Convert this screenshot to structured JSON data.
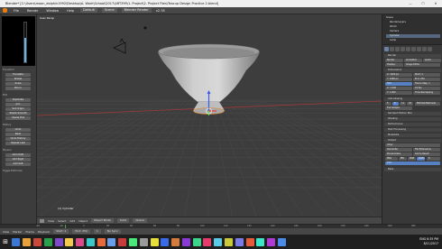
{
  "window": {
    "title": "Blender* [C:\\Users\\moon_dolphin1992\\Desktop\\A. Work\\School\\2017\\ART399\\1. Project\\2. Project Files\\Teacup Design Practice 2.blend]"
  },
  "info_header": {
    "menus": [
      "File",
      "Render",
      "Window",
      "Help"
    ],
    "layout": "Default",
    "scene": "Scene",
    "engine": "Blender Render",
    "version": "v2.78",
    "stats": "Verts:64 | Faces:62 | Tris:120 | Objects:1/3 | Lamps:0/1 | Mem:8.64M | Cylinder"
  },
  "tool_shelf": {
    "sections": [
      {
        "label": "Transform",
        "buttons": [
          "Translate",
          "Rotate",
          "Scale",
          "Mirror"
        ]
      },
      {
        "label": "Edit",
        "buttons": [
          "Duplicate",
          "Join",
          "Set Origin",
          "Shade Smooth",
          "Shade Flat"
        ]
      },
      {
        "label": "History",
        "buttons": [
          "Undo",
          "Redo",
          "Undo History",
          "Repeat Last"
        ]
      },
      {
        "label": "Physics",
        "buttons": [
          "Add Cloth",
          "Add Rigid",
          "Add Soft"
        ]
      }
    ],
    "footer": "Toggle Editmode",
    "brush_level": 0.62
  },
  "viewport": {
    "label": "User Persp",
    "object_label": "(1) Cylinder",
    "header": {
      "view": "View",
      "select": "Select",
      "add": "Add",
      "object": "Object",
      "mode": "Object Mode",
      "shading": "Solid",
      "pivot": "Global"
    }
  },
  "outliner": {
    "rows": [
      "Scene",
      "RenderLayers",
      "World",
      "Camera",
      "Cylinder",
      "Lamp"
    ],
    "active": 4
  },
  "properties": {
    "sections": [
      "Render",
      "Dimensions",
      "Anti-Aliasing",
      "Sampled Motion Blur",
      "Shading",
      "Performance",
      "Post Processing",
      "Metadata",
      "Output",
      "Bake"
    ],
    "render_buttons": [
      "Render",
      "Animation",
      "Audio"
    ],
    "display": "Display:",
    "display_value": "Image Editor",
    "resolution_x": "X: 1920 px",
    "resolution_y": "Y: 1080 px",
    "resolution_pct": "50%",
    "frame_start": "Start: 1",
    "frame_end": "End: 250",
    "frame_step": "Frame Step: 1",
    "aspect_x": "X: 1.000",
    "aspect_y": "Y: 1.000",
    "fps": "24 fps",
    "time_remap": "Time Remapping",
    "aa_samples": [
      "5",
      "8",
      "11",
      "16"
    ],
    "filter": "Mitchell-Netravali",
    "full_sample": "Full Sample",
    "output_path": "/tmp/",
    "file_format": "PNG",
    "color_mode": [
      "BW",
      "RGB",
      "RGBA"
    ],
    "color_depth": "8",
    "compression": "15%",
    "overwrite": "Overwrite",
    "placeholders": "Placeholders",
    "file_extensions": "File Extensions",
    "cache_result": "Cache Result"
  },
  "timeline": {
    "ticks": [
      "-40",
      "-20",
      "0",
      "20",
      "40",
      "60",
      "80",
      "100",
      "120",
      "140",
      "160",
      "180",
      "200",
      "220",
      "240",
      "260",
      "280"
    ],
    "header": {
      "view": "View",
      "marker": "Marker",
      "frame": "Frame",
      "playback": "Playback",
      "start": "Start: 1",
      "end": "End: 250",
      "current": "1",
      "sync": "No Sync"
    }
  },
  "taskbar": {
    "time": "6:35 PM",
    "date": "8/11/2017",
    "lang": "ENG",
    "icon_colors": [
      "#3b78d4",
      "#e8a13a",
      "#c94a3a",
      "#2aa04a",
      "#7d4ac9",
      "#f2c94c",
      "#d94a8a",
      "#3ac9c9",
      "#e86a3a",
      "#6a9de8",
      "#c93a3a",
      "#4ae87a",
      "#9a9a9a",
      "#e8e03a",
      "#3a6ae8",
      "#d47a3a",
      "#8a3ad4",
      "#3ad48a",
      "#e83a6a",
      "#5ac9e8",
      "#c9c93a",
      "#7a7ae8",
      "#e85a3a",
      "#3ae8c9",
      "#b03ad4",
      "#4a8ae8"
    ]
  }
}
